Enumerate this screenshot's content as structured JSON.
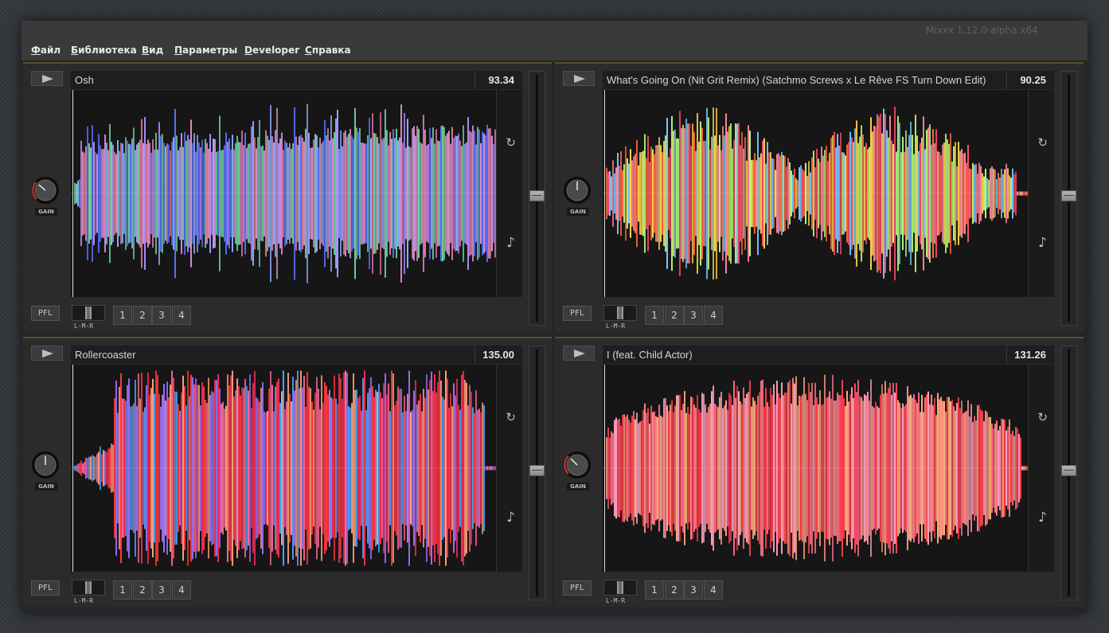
{
  "window": {
    "title": "Mixxx 1.12.0-alpha x64"
  },
  "menu": [
    {
      "label": "Файл",
      "accel": "Ф",
      "rest": "айл"
    },
    {
      "label": "Библиотека",
      "accel": "Б",
      "rest": "иблиотека"
    },
    {
      "label": "Вид",
      "accel": "В",
      "rest": "ид"
    },
    {
      "label": "Параметры",
      "accel": "П",
      "rest": "араметры"
    },
    {
      "label": "Developer",
      "accel": "D",
      "rest": "eveloper"
    },
    {
      "label": "Справка",
      "accel": "С",
      "rest": "правка"
    }
  ],
  "controls": {
    "gain_label": "GAIN",
    "pfl_label": "PFL",
    "orientation_label": "L-M-R",
    "hotcues": [
      "1",
      "2",
      "3",
      "4"
    ],
    "repeat_icon": "repeat-icon",
    "note_icon": "music-note-icon"
  },
  "decks": [
    {
      "title": "Osh",
      "bpm": "93.34",
      "palette": [
        "#6fd0a0",
        "#8fb0ff",
        "#5a70ff",
        "#b090ff",
        "#d98fd0",
        "#e07aa0"
      ],
      "shape": "flat"
    },
    {
      "title": "What's Going On (Nit Grit Remix) (Satchmo Screws x Le Rêve FS Turn Down Edit)",
      "bpm": "90.25",
      "palette": [
        "#ff6a3a",
        "#ffd24a",
        "#ff4a6a",
        "#ff8aa0",
        "#7ac8ff",
        "#b8ff7a"
      ],
      "shape": "rise"
    },
    {
      "title": "Rollercoaster",
      "bpm": "135.00",
      "palette": [
        "#ff2d55",
        "#ff3a3a",
        "#a070ff",
        "#4aa0ff",
        "#ff6a9a",
        "#ffa07a"
      ],
      "shape": "blocks"
    },
    {
      "title": "I (feat. Child Actor)",
      "bpm": "131.26",
      "palette": [
        "#ff8a7a",
        "#ff4a5a",
        "#ffb080",
        "#ff6a8a",
        "#ff3a4a",
        "#ffa0c0"
      ],
      "shape": "hump"
    }
  ]
}
